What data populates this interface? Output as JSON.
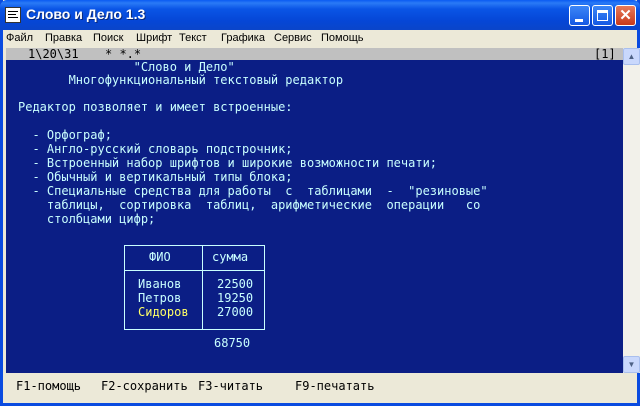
{
  "window": {
    "title": "Слово и Дело 1.3",
    "minimize": "minimize",
    "maximize": "maximize",
    "close": "✕"
  },
  "menu": [
    "Файл",
    "Правка",
    "Поиск",
    "Шрифт",
    "Текст",
    "Графика",
    "Сервис",
    "Помощь"
  ],
  "editor": {
    "status_left": "1\\20\\31",
    "status_mid": "* *.*",
    "status_right": "[1]",
    "lines": [
      "                \"Слово и Дело\"",
      "       Многофункциональный текстовый редактор",
      "",
      "Редактор позволяет и имеет встроенные:",
      "",
      "  - Орфограф;",
      "  - Англо-русский словарь подстрочник;",
      "  - Встроенный набор шрифтов и широкие возможности печати;",
      "  - Обычный и вертикальный типы блока;",
      "  - Специальные средства для работы  с  таблицами  -  \"резиновые\"",
      "    таблицы,  сортировка  таблиц,  арифметические  операции   со",
      "    столбцами цифр;"
    ],
    "table": {
      "headers": [
        "ФИО",
        "сумма"
      ],
      "rows": [
        {
          "name": "Иванов",
          "sum": "22500"
        },
        {
          "name": "Петров",
          "sum": "19250"
        },
        {
          "name": "Сидоров",
          "sum": "27000"
        }
      ],
      "total": "68750"
    }
  },
  "function_keys": [
    "F1-помощь",
    "F2-сохранить",
    "F3-читать",
    "F9-печатать"
  ],
  "colors": {
    "editor_bg": "#0b1e85",
    "editor_text": "#c9ffff",
    "highlight_text": "#ffff66",
    "titlebar": "#0a55e6"
  },
  "icons": {
    "scroll_up": "▲",
    "scroll_down": "▼"
  }
}
